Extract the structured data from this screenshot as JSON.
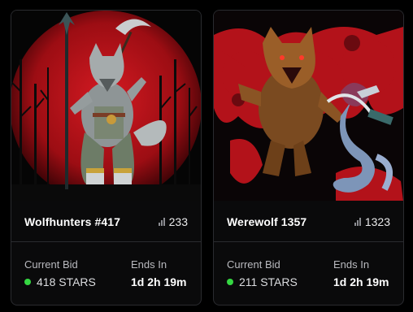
{
  "cards": [
    {
      "title": "Wolfhunters #417",
      "views": "233",
      "bid_label": "Current Bid",
      "bid_value": "418 STARS",
      "ends_label": "Ends In",
      "ends_value": "1d 2h 19m",
      "artwork": "wolf-warrior-artwork"
    },
    {
      "title": "Werewolf 1357",
      "views": "1323",
      "bid_label": "Current Bid",
      "bid_value": "211 STARS",
      "ends_label": "Ends In",
      "ends_value": "1d 2h 19m",
      "artwork": "werewolf-vs-serpent-artwork"
    }
  ],
  "icons": {
    "views": "signal-bars-icon",
    "status": "green-live-dot"
  },
  "colors": {
    "status_green": "#35d742",
    "card_border": "#2a2b2f",
    "art_red": "#b3121a"
  }
}
